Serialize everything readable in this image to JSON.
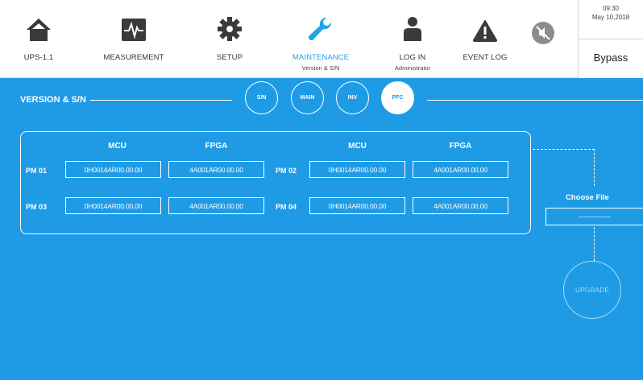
{
  "nav": {
    "items": [
      {
        "id": "ups",
        "label": "UPS-1.1",
        "icon": "home-icon"
      },
      {
        "id": "measurement",
        "label": "MEASUREMENT",
        "icon": "waveform-icon"
      },
      {
        "id": "setup",
        "label": "SETUP",
        "icon": "gear-icon"
      },
      {
        "id": "maintenance",
        "label": "MAINTENANCE",
        "sub": "Version & S/N",
        "icon": "wrench-icon",
        "active": true
      },
      {
        "id": "login",
        "label": "LOG IN",
        "sub": "Administrator",
        "icon": "user-icon"
      },
      {
        "id": "eventlog",
        "label": "EVENT LOG",
        "icon": "warning-icon"
      }
    ]
  },
  "status": {
    "time": "09:30",
    "date": "May 10,2018",
    "mode": "Bypass"
  },
  "colors": {
    "accent": "#1fa5e8",
    "background": "#1e9be4"
  },
  "section": {
    "title": "VERSION & S/N"
  },
  "tabs": [
    {
      "id": "sn",
      "label": "S/N",
      "active": false
    },
    {
      "id": "main",
      "label": "MAIN",
      "active": false
    },
    {
      "id": "inv",
      "label": "INV",
      "active": false
    },
    {
      "id": "pfc",
      "label": "PFC",
      "active": true
    }
  ],
  "firmware": {
    "headers": {
      "mcu": "MCU",
      "fpga": "FPGA"
    },
    "modules": [
      {
        "name": "PM 01",
        "mcu": "0H0014AR00.00.00",
        "fpga": "4A001AR00.00.00"
      },
      {
        "name": "PM 02",
        "mcu": "0H0014AR00.00.00",
        "fpga": "4A001AR00.00.00"
      },
      {
        "name": "PM 03",
        "mcu": "0H0014AR00.00.00",
        "fpga": "4A001AR00.00.00"
      },
      {
        "name": "PM 04",
        "mcu": "0H0014AR00.00.00",
        "fpga": "4A001AR00.00.00"
      }
    ]
  },
  "upgrade": {
    "choose_label": "Choose File",
    "file_value": "-------------",
    "button_label": "UPGRADE"
  }
}
